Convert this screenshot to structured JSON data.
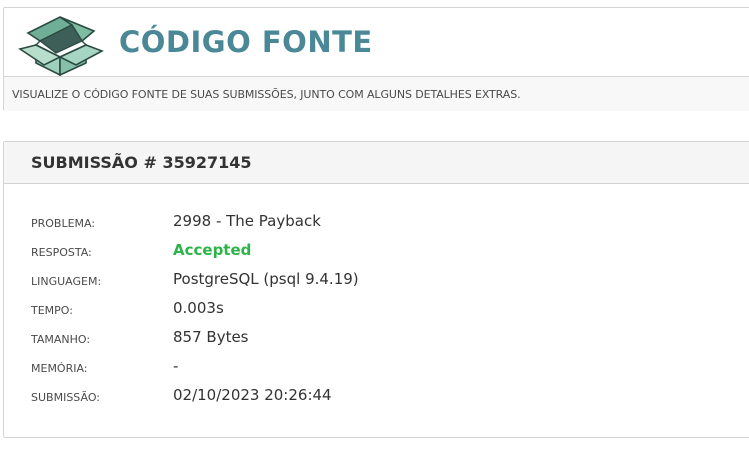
{
  "header": {
    "logo_icon": "open-box-icon",
    "title": "CÓDIGO FONTE",
    "subtitle": "VISUALIZE O CÓDIGO FONTE DE SUAS SUBMISSÕES, JUNTO COM ALGUNS DETALHES EXTRAS.",
    "title_color": "#4a8898"
  },
  "submission": {
    "title": "SUBMISSÃO # 35927145",
    "details": [
      {
        "label": "PROBLEMA:",
        "value": "2998 - The Payback"
      },
      {
        "label": "RESPOSTA:",
        "value": "Accepted"
      },
      {
        "label": "LINGUAGEM:",
        "value": "PostgreSQL (psql 9.4.19)"
      },
      {
        "label": "TEMPO:",
        "value": "0.003s"
      },
      {
        "label": "TAMANHO:",
        "value": "857 Bytes"
      },
      {
        "label": "MEMÓRIA:",
        "value": "-"
      },
      {
        "label": "SUBMISSÃO:",
        "value": "02/10/2023 20:26:44"
      }
    ],
    "accepted_color": "#2db34a"
  }
}
